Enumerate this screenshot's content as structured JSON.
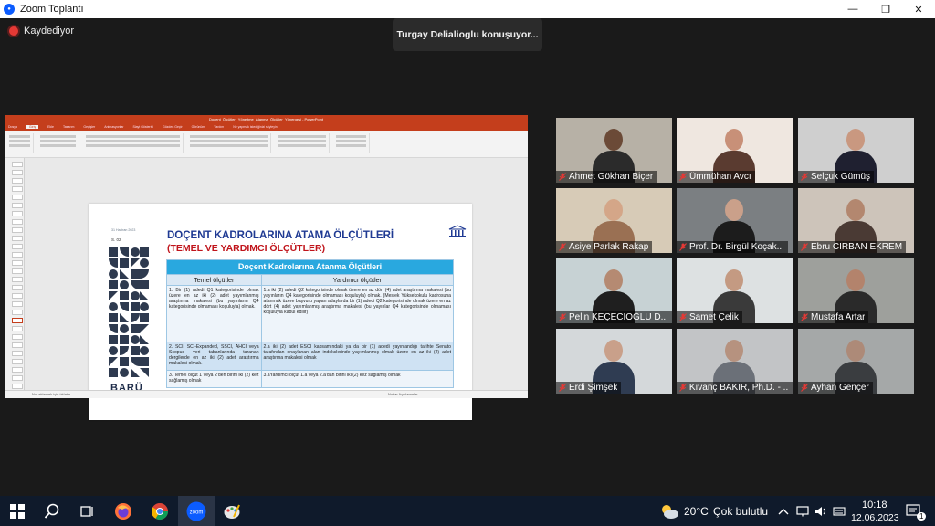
{
  "window": {
    "title": "Zoom Toplantı",
    "buttons": {
      "minimize": "—",
      "maximize": "❐",
      "close": "✕"
    }
  },
  "recording": {
    "label": "Kaydediyor"
  },
  "speaker_banner": "Turgay Delialioglu konuşuyor...",
  "presentation": {
    "app_title": "Doçent_Ölçütleri_Yöneltme_Atanma_Ölçütler_Yönergesi - PowerPoint",
    "ribbon_tabs": [
      "Dosya",
      "Giriş",
      "Ekle",
      "Tasarım",
      "Geçişler",
      "Animasyonlar",
      "Slayt Gösterisi",
      "Gözden Geçir",
      "Görünüm",
      "Yardım",
      "Ne yapmak istediğinizi söyleyin"
    ],
    "active_tab": "Giriş",
    "status_left": "Not eklemek için tıklatın",
    "status_right": "Notlar   Açıklamalar",
    "slide": {
      "date": "31 Haziran 2023",
      "number": "S. 02",
      "title": "DOÇENT KADROLARINA ATAMA ÖLÇÜTLERİ",
      "subtitle": "(TEMEL VE YARDIMCI ÖLÇÜTLER)",
      "logo_text": "BARÜ",
      "logo_sub": "BARTIN ÜNİVERSİTESİ",
      "table": {
        "caption": "Doçent Kadrolarına Atanma Ölçütleri",
        "headers": [
          "Temel ölçütler",
          "Yardımcı ölçütler"
        ],
        "rows": [
          [
            "1. Bir (1) adedi Q1 kategorisinde olmak üzere en az iki (2) adet yayımlanmış araştırma makalesi (bu yayınların Q4 kategorisinde olmaması koşuluyla) olmak.",
            "1.a iki (2) adedi Q2 kategorisinde olmak üzere en az dört (4) adet araştırma makalesi (bu yayınların Q4 kategorisinde olmaması koşuluyla) olmak. (Meslek Yüksekokulu kadrosuna atanmak üzere başvuru yapan adaylarda bir (1) adedi Q2 kategorisinde olmak üzere en az dört (4) adet yayımlanmış araştırma makalesi (bu yayınlar Q4 kategorisinde olmaması koşuluyla kabul edilir)"
          ],
          [
            "2. SCI, SCI-Expanded, SSCI, AHCI veya Scopus veri tabanlarında taranan dergilerde en az iki (2) adet araştırma makalesi olmak.",
            "2.a iki (2) adet ESCI kapsamındaki ya da bir (1) adedi yayınlandığı tarihte Senato tarafından onaylanan alan indekslerinde yayımlanmış olmak üzere en az iki (2) adet araştırma makalesi olmak"
          ],
          [
            "3. Temel ölçüt 1 veya 2'den birini iki (2) kez sağlamış olmak",
            "3.aYardımcı ölçüt 1.a veya 2.a'dan birini iki (2) kez sağlamış olmak"
          ]
        ]
      }
    }
  },
  "participants": [
    {
      "name": "Ahmet Gökhan Biçer",
      "bg": "#b7b1a6",
      "skin": "#6b4a37",
      "cloth": "#2b2b2b"
    },
    {
      "name": "Ümmühan Avcı",
      "bg": "#efe7e0",
      "skin": "#c89078",
      "cloth": "#5a3b30"
    },
    {
      "name": "Selçuk Gümüş",
      "bg": "#cfcfcf",
      "skin": "#c99880",
      "cloth": "#1f2030"
    },
    {
      "name": "Asiye Parlak Rakap",
      "bg": "#d7cbb7",
      "skin": "#d4a688",
      "cloth": "#9a7053"
    },
    {
      "name": "Prof. Dr. Birgül Koçak...",
      "bg": "#7b7f82",
      "skin": "#caa08a",
      "cloth": "#1c1c1c"
    },
    {
      "name": "Ebru CİRBAN EKREM",
      "bg": "#cdc4ba",
      "skin": "#b3876f",
      "cloth": "#4a3a34"
    },
    {
      "name": "Pelin KEÇECİOĞLU D...",
      "bg": "#c7d2d4",
      "skin": "#b58a72",
      "cloth": "#1f1f1f"
    },
    {
      "name": "Samet Çelik",
      "bg": "#dde1e2",
      "skin": "#c49a82",
      "cloth": "#3a3a3a"
    },
    {
      "name": "Mustafa Artar",
      "bg": "#9ea09c",
      "skin": "#b3836c",
      "cloth": "#2a2a2a"
    },
    {
      "name": "Erdi Şimşek",
      "bg": "#d4d8da",
      "skin": "#c9a08a",
      "cloth": "#2f3c52"
    },
    {
      "name": "Kıvanç BAKIR, Ph.D. - ...",
      "bg": "#c2c4c6",
      "skin": "#b6927f",
      "cloth": "#6b7078"
    },
    {
      "name": "Ayhan Gençer",
      "bg": "#a5a8a8",
      "skin": "#ad8a78",
      "cloth": "#3a3d40"
    }
  ],
  "taskbar": {
    "weather_temp": "20°C",
    "weather_text": "Çok bulutlu",
    "time": "10:18",
    "date": "12.06.2023",
    "notifications": "1"
  }
}
